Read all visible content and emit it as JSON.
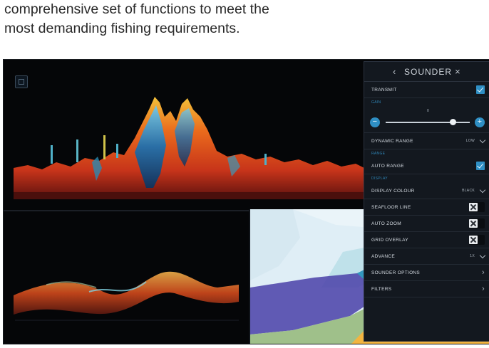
{
  "caption": {
    "line1": "comprehensive set of functions to meet the",
    "line2": "most demanding fishing requirements."
  },
  "panel": {
    "title": "SOUNDER",
    "back_icon": "chevron-left-icon",
    "close_icon": "close-icon",
    "transmit": {
      "label": "TRANSMIT",
      "checked": true
    },
    "gain": {
      "section": "GAIN",
      "value": "0",
      "minus": "−",
      "plus": "+",
      "level": 0.8
    },
    "dynamic_range": {
      "label": "DYNAMIC RANGE",
      "value": "LOW"
    },
    "range": {
      "section": "RANGE",
      "label": "AUTO RANGE",
      "checked": true
    },
    "display": {
      "section": "DISPLAY"
    },
    "display_colour": {
      "label": "DISPLAY COLOUR",
      "value": "BLACK"
    },
    "seafloor_line": {
      "label": "SEAFLOOR LINE",
      "checked": false
    },
    "auto_zoom": {
      "label": "AUTO ZOOM",
      "checked": false
    },
    "grid_overlay": {
      "label": "GRID OVERLAY",
      "checked": false
    },
    "advance": {
      "label": "ADVANCE",
      "value": "1X"
    },
    "sounder_options": {
      "label": "SOUNDER OPTIONS"
    },
    "filters": {
      "label": "FILTERS"
    }
  },
  "colors": {
    "accent": "#2f8fc4",
    "panel_bg": "#13181f",
    "land": "#f2b440",
    "shore_green": "#9fc08a",
    "water": "#dfeef6"
  }
}
